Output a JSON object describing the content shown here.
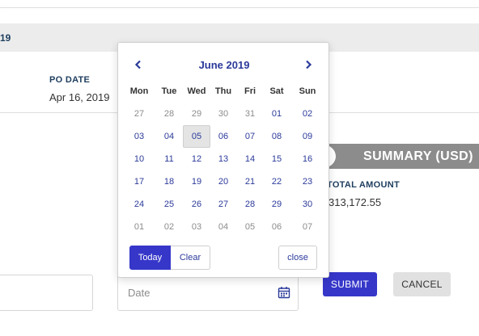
{
  "header_band": {
    "text": "19"
  },
  "po_date": {
    "label": "PO DATE",
    "value": "Apr 16, 2019"
  },
  "summary": {
    "title": "SUMMARY (USD)",
    "total_label": "TOTAL AMOUNT",
    "total_value": "313,172.55"
  },
  "date_field": {
    "placeholder": "Date",
    "icon": "calendar-icon"
  },
  "actions": {
    "submit_label": "SUBMIT",
    "cancel_label": "CANCEL"
  },
  "datepicker": {
    "month_label": "June 2019",
    "prev_icon": "chevron-left-icon",
    "next_icon": "chevron-right-icon",
    "weekdays": [
      "Mon",
      "Tue",
      "Wed",
      "Thu",
      "Fri",
      "Sat",
      "Sun"
    ],
    "weeks": [
      [
        {
          "d": "27",
          "out": true
        },
        {
          "d": "28",
          "out": true
        },
        {
          "d": "29",
          "out": true
        },
        {
          "d": "30",
          "out": true
        },
        {
          "d": "31",
          "out": true
        },
        {
          "d": "01"
        },
        {
          "d": "02"
        }
      ],
      [
        {
          "d": "03"
        },
        {
          "d": "04"
        },
        {
          "d": "05",
          "selected": true
        },
        {
          "d": "06"
        },
        {
          "d": "07"
        },
        {
          "d": "08"
        },
        {
          "d": "09"
        }
      ],
      [
        {
          "d": "10"
        },
        {
          "d": "11"
        },
        {
          "d": "12"
        },
        {
          "d": "13"
        },
        {
          "d": "14"
        },
        {
          "d": "15"
        },
        {
          "d": "16"
        }
      ],
      [
        {
          "d": "17"
        },
        {
          "d": "18"
        },
        {
          "d": "19"
        },
        {
          "d": "20"
        },
        {
          "d": "21"
        },
        {
          "d": "22"
        },
        {
          "d": "23"
        }
      ],
      [
        {
          "d": "24"
        },
        {
          "d": "25"
        },
        {
          "d": "26"
        },
        {
          "d": "27"
        },
        {
          "d": "28"
        },
        {
          "d": "29"
        },
        {
          "d": "30"
        }
      ],
      [
        {
          "d": "01",
          "out": true
        },
        {
          "d": "02",
          "out": true
        },
        {
          "d": "03",
          "out": true
        },
        {
          "d": "04",
          "out": true
        },
        {
          "d": "05",
          "out": true
        },
        {
          "d": "06",
          "out": true
        },
        {
          "d": "07",
          "out": true
        }
      ]
    ],
    "today_label": "Today",
    "clear_label": "Clear",
    "close_label": "close"
  },
  "colors": {
    "primary": "#3637c9",
    "link": "#2b3a9a",
    "summary_bar": "#8c8c8c",
    "band": "#ececec",
    "label": "#1d3d5e"
  }
}
